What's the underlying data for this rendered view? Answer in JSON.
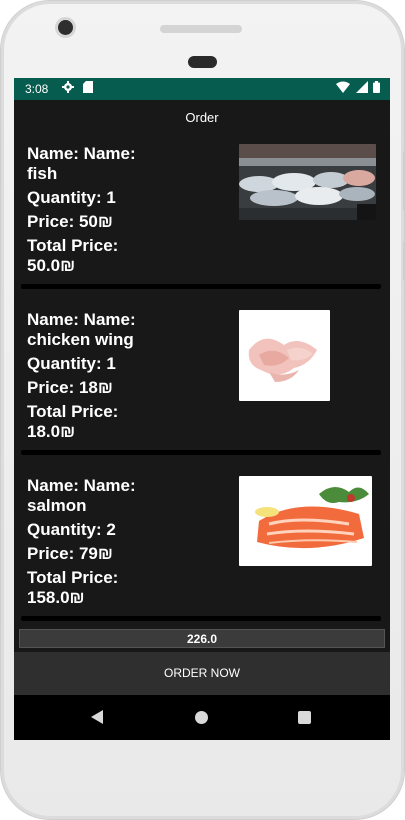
{
  "status_bar": {
    "time": "3:08",
    "left_icons": [
      "gear-icon",
      "sd-card-icon"
    ],
    "right_icons": [
      "wifi-icon",
      "signal-icon",
      "battery-icon"
    ],
    "background_color": "#055c4f"
  },
  "app_bar": {
    "title": "Order"
  },
  "orders": [
    {
      "name_text": "Name: Name:",
      "item": "fish",
      "quantity_text": "Quantity: 1",
      "price_text": "Price: 50₪",
      "total_label": "Total Price:",
      "total_value": "50.0₪",
      "image": "fish-market-photo"
    },
    {
      "name_text": "Name: Name:",
      "item": "chicken wing",
      "quantity_text": "Quantity: 1",
      "price_text": "Price: 18₪",
      "total_label": "Total Price:",
      "total_value": "18.0₪",
      "image": "chicken-wing-photo"
    },
    {
      "name_text": "Name: Name:",
      "item": "salmon",
      "quantity_text": "Quantity: 2",
      "price_text": "Price: 79₪",
      "total_label": "Total Price:",
      "total_value": "158.0₪",
      "image": "salmon-fillet-photo"
    }
  ],
  "grand_total": "226.0",
  "order_button_label": "ORDER NOW",
  "nav_bar": {
    "buttons": [
      "back-icon",
      "home-icon",
      "recents-icon"
    ]
  }
}
